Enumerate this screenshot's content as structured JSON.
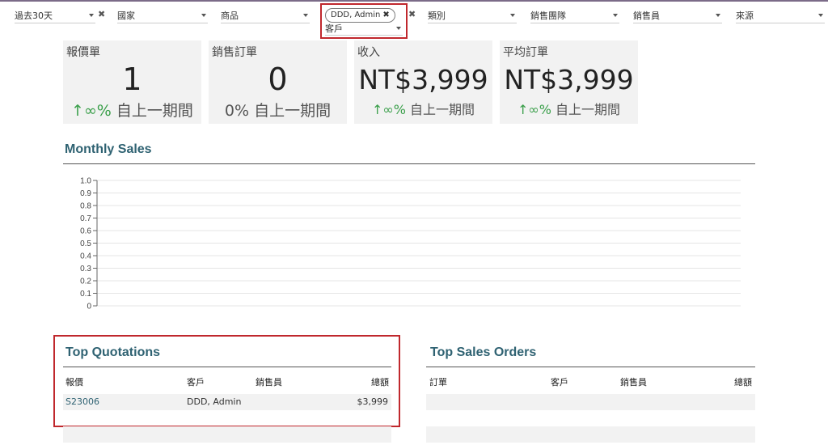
{
  "filters": {
    "period": "過去30天",
    "country": "國家",
    "product": "商品",
    "customer_tag": "DDD, Admin",
    "customer_label": "客戶",
    "category": "類別",
    "sales_team": "銷售團隊",
    "salesperson": "銷售員",
    "source": "來源"
  },
  "kpis": [
    {
      "title": "報價單",
      "value": "1",
      "change_arrow": "↑",
      "change_pct": "∞%",
      "change_text": "自上一期間"
    },
    {
      "title": "銷售訂單",
      "value": "0",
      "change_arrow": "",
      "change_pct": "0%",
      "change_text": "自上一期間"
    },
    {
      "title": "收入",
      "value": "NT$3,999",
      "change_arrow": "↑",
      "change_pct": "∞%",
      "change_text": "自上一期間"
    },
    {
      "title": "平均訂單",
      "value": "NT$3,999",
      "change_arrow": "↑",
      "change_pct": "∞%",
      "change_text": "自上一期間"
    }
  ],
  "monthly_sales": {
    "title": "Monthly Sales"
  },
  "chart_data": {
    "type": "line",
    "title": "Monthly Sales",
    "xlabel": "",
    "ylabel": "",
    "ylim": [
      0,
      1.0
    ],
    "yticks": [
      "0",
      "0.1",
      "0.2",
      "0.3",
      "0.4",
      "0.5",
      "0.6",
      "0.7",
      "0.8",
      "0.9",
      "1.0"
    ],
    "grid": true,
    "series": []
  },
  "top_quotations": {
    "title": "Top Quotations",
    "columns": [
      "報價",
      "客戶",
      "銷售員",
      "總額"
    ],
    "rows": [
      {
        "ref": "S23006",
        "customer": "DDD, Admin",
        "salesperson": "",
        "total": "$3,999"
      }
    ]
  },
  "top_sales_orders": {
    "title": "Top Sales Orders",
    "columns": [
      "訂單",
      "客戶",
      "銷售員",
      "總額"
    ],
    "rows": []
  },
  "colors": {
    "accent": "#2f6272",
    "positive": "#3a9f4a",
    "highlight": "#c0282d",
    "tile_bg": "#f2f2f2"
  }
}
